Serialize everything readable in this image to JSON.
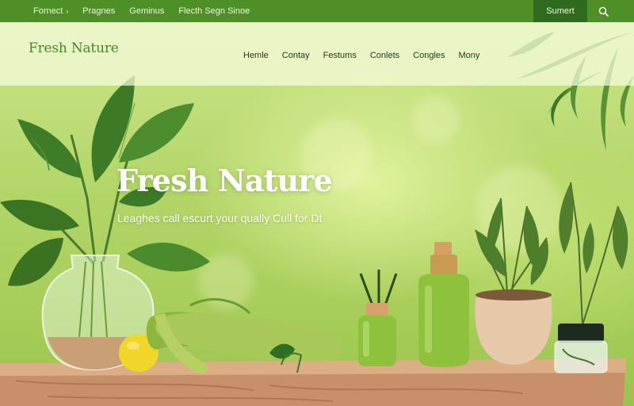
{
  "topbar": {
    "links": [
      {
        "label": "Fornect",
        "has_arrow": true
      },
      {
        "label": "Pragnes"
      },
      {
        "label": "Geminus"
      },
      {
        "label": "Flecth Segn Sinoe"
      }
    ],
    "arrow_glyph": "›",
    "submit_label": "Sumert",
    "search_icon": "search-icon",
    "background_color": "#4f8f28",
    "submit_color": "#2f6b1f"
  },
  "header": {
    "logo_text": "Fresh Nature",
    "logo_color": "#3f8a2c",
    "nav": [
      "Hemle",
      "Contay",
      "Festums",
      "Conlets",
      "Congles",
      "Mony"
    ]
  },
  "hero": {
    "title": "Fresh Nature",
    "subtitle": "Leaghes call escurt your qually Cull for Dt"
  }
}
